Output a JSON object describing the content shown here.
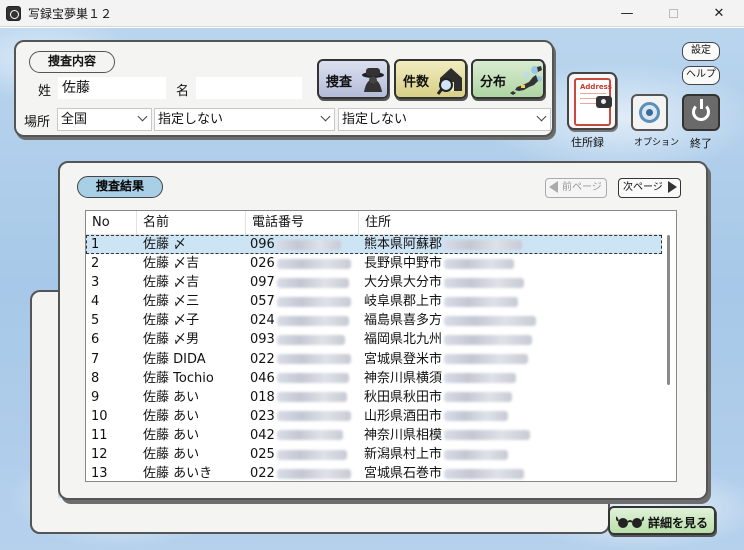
{
  "window": {
    "title": "写録宝夢巣１２",
    "controls": {
      "minimize": "—",
      "maximize": "",
      "close": "✕"
    }
  },
  "search": {
    "section_label": "捜査内容",
    "surname_label": "姓",
    "surname_value": "佐藤",
    "given_label": "名",
    "given_value": "",
    "place_label": "場所",
    "prefecture": "全国",
    "city": "指定しない",
    "town": "指定しない",
    "buttons": {
      "search": "捜査",
      "count": "件数",
      "distribution": "分布"
    }
  },
  "side": {
    "address_book_word": "Address",
    "address_book_label": "住所録",
    "options_label": "オプション",
    "exit_label": "終了",
    "settings": "設定",
    "help": "ヘルプ"
  },
  "results": {
    "section_label": "捜査結果",
    "prev_page": "前ページ",
    "next_page": "次ページ",
    "columns": [
      "No",
      "名前",
      "電話番号",
      "住所"
    ],
    "rows": [
      {
        "no": "1",
        "name": "佐藤 〆",
        "tel": "096",
        "addr": "熊本県阿蘇郡"
      },
      {
        "no": "2",
        "name": "佐藤 〆吉",
        "tel": "026",
        "addr": "長野県中野市"
      },
      {
        "no": "3",
        "name": "佐藤 〆吉",
        "tel": "097",
        "addr": "大分県大分市"
      },
      {
        "no": "4",
        "name": "佐藤 〆三",
        "tel": "057",
        "addr": "岐阜県郡上市"
      },
      {
        "no": "5",
        "name": "佐藤 〆子",
        "tel": "024",
        "addr": "福島県喜多方"
      },
      {
        "no": "6",
        "name": "佐藤 〆男",
        "tel": "093",
        "addr": "福岡県北九州"
      },
      {
        "no": "7",
        "name": "佐藤 DIDA",
        "tel": "022",
        "addr": "宮城県登米市"
      },
      {
        "no": "8",
        "name": "佐藤 Tochio",
        "tel": "046",
        "addr": "神奈川県横須"
      },
      {
        "no": "9",
        "name": "佐藤 あい",
        "tel": "018",
        "addr": "秋田県秋田市"
      },
      {
        "no": "10",
        "name": "佐藤 あい",
        "tel": "023",
        "addr": "山形県酒田市"
      },
      {
        "no": "11",
        "name": "佐藤 あい",
        "tel": "042",
        "addr": "神奈川県相模"
      },
      {
        "no": "12",
        "name": "佐藤 あい",
        "tel": "025",
        "addr": "新潟県村上市"
      },
      {
        "no": "13",
        "name": "佐藤 あいき",
        "tel": "022",
        "addr": "宮城県石巻市"
      }
    ],
    "selected_row": 1,
    "detail_button": "詳細を見る"
  },
  "colors": {
    "sky": "#a7c8e8",
    "panel": "#f4f4f2",
    "selection": "#cde4f5",
    "results_label": "#a9cfe6"
  }
}
